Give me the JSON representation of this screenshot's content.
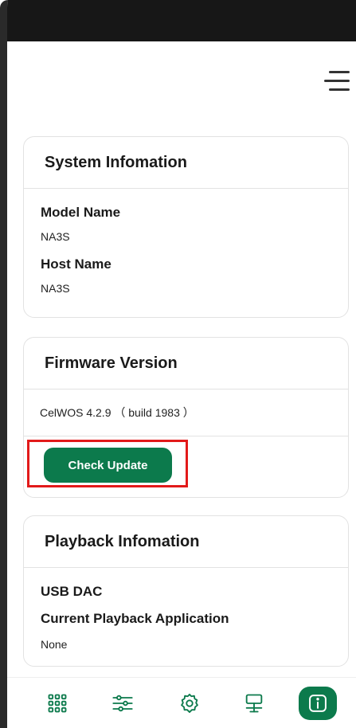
{
  "system_info": {
    "title": "System Infomation",
    "model_name_label": "Model Name",
    "model_name_value": "NA3S",
    "host_name_label": "Host Name",
    "host_name_value": "NA3S"
  },
  "firmware": {
    "title": "Firmware Version",
    "version": "CelWOS 4.2.9 （ build 1983 ）",
    "check_update_label": "Check Update"
  },
  "playback": {
    "title": "Playback Infomation",
    "usb_dac_label": "USB DAC",
    "current_app_label": "Current Playback Application",
    "current_app_value": "None"
  },
  "nav": {
    "items": [
      "grid-icon",
      "sliders-icon",
      "gear-icon",
      "network-icon",
      "info-icon"
    ],
    "active": "info-icon"
  },
  "colors": {
    "accent": "#0c7a4c",
    "highlight": "#e21a1a",
    "statusbar": "#171717"
  }
}
